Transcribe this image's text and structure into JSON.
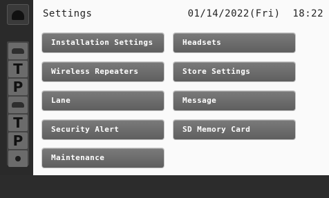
{
  "header": {
    "title": "Settings",
    "datetime": "01/14/2022(Fri)  18:22"
  },
  "menu": {
    "left": [
      {
        "label": "Installation Settings"
      },
      {
        "label": "Wireless Repeaters"
      },
      {
        "label": "Lane"
      },
      {
        "label": "Security Alert"
      },
      {
        "label": "Maintenance"
      }
    ],
    "right": [
      {
        "label": "Headsets"
      },
      {
        "label": "Store Settings"
      },
      {
        "label": "Message"
      },
      {
        "label": "SD Memory Card"
      }
    ]
  },
  "rail": {
    "icons": [
      "home-icon",
      "car-icon",
      "T",
      "P",
      "car-icon",
      "T",
      "P",
      "dot-icon"
    ]
  }
}
